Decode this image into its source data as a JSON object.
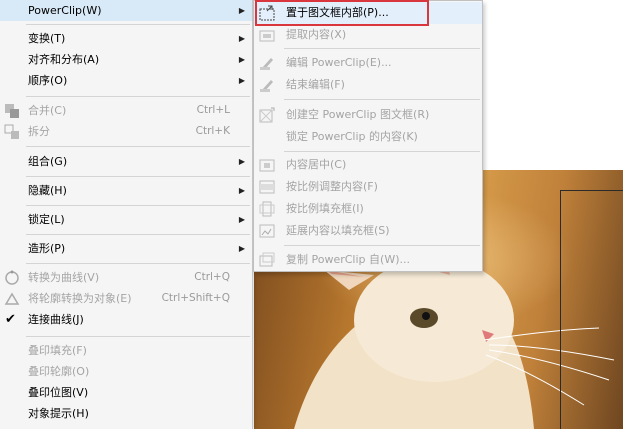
{
  "main_menu": {
    "items": [
      {
        "label": "PowerClip(W)",
        "shortcut": "",
        "submenu": true,
        "disabled": false
      },
      {
        "label": "变换(T)",
        "shortcut": "",
        "submenu": true,
        "disabled": false
      },
      {
        "label": "对齐和分布(A)",
        "shortcut": "",
        "submenu": true,
        "disabled": false
      },
      {
        "label": "顺序(O)",
        "shortcut": "",
        "submenu": true,
        "disabled": false
      },
      {
        "label": "合并(C)",
        "shortcut": "Ctrl+L",
        "submenu": false,
        "disabled": true
      },
      {
        "label": "拆分",
        "shortcut": "Ctrl+K",
        "submenu": false,
        "disabled": true
      },
      {
        "label": "组合(G)",
        "shortcut": "",
        "submenu": true,
        "disabled": false
      },
      {
        "label": "隐藏(H)",
        "shortcut": "",
        "submenu": true,
        "disabled": false
      },
      {
        "label": "锁定(L)",
        "shortcut": "",
        "submenu": true,
        "disabled": false
      },
      {
        "label": "造形(P)",
        "shortcut": "",
        "submenu": true,
        "disabled": false
      },
      {
        "label": "转换为曲线(V)",
        "shortcut": "Ctrl+Q",
        "submenu": false,
        "disabled": true
      },
      {
        "label": "将轮廓转换为对象(E)",
        "shortcut": "Ctrl+Shift+Q",
        "submenu": false,
        "disabled": true
      },
      {
        "label": "连接曲线(J)",
        "shortcut": "",
        "submenu": false,
        "disabled": false,
        "checked": true
      },
      {
        "label": "叠印填充(F)",
        "shortcut": "",
        "submenu": false,
        "disabled": true
      },
      {
        "label": "叠印轮廓(O)",
        "shortcut": "",
        "submenu": false,
        "disabled": true
      },
      {
        "label": "叠印位图(V)",
        "shortcut": "",
        "submenu": false,
        "disabled": false
      },
      {
        "label": "对象提示(H)",
        "shortcut": "",
        "submenu": false,
        "disabled": false
      }
    ]
  },
  "powerclip_submenu": {
    "items": [
      {
        "label": "置于图文框内部(P)...",
        "disabled": false,
        "icon": "place-inside-frame-icon"
      },
      {
        "label": "提取内容(X)",
        "disabled": true,
        "icon": "extract-contents-icon"
      },
      {
        "label": "编辑 PowerClip(E)...",
        "disabled": true,
        "icon": "edit-powerclip-icon"
      },
      {
        "label": "结束编辑(F)",
        "disabled": true,
        "icon": "finish-editing-icon"
      },
      {
        "label": "创建空 PowerClip 图文框(R)",
        "disabled": true,
        "icon": "create-empty-frame-icon"
      },
      {
        "label": "锁定 PowerClip 的内容(K)",
        "disabled": true,
        "icon": ""
      },
      {
        "label": "内容居中(C)",
        "disabled": true,
        "icon": "center-content-icon"
      },
      {
        "label": "按比例调整内容(F)",
        "disabled": true,
        "icon": "fit-content-proportionally-icon"
      },
      {
        "label": "按比例填充框(I)",
        "disabled": true,
        "icon": "fill-frame-proportionally-icon"
      },
      {
        "label": "延展内容以填充框(S)",
        "disabled": true,
        "icon": "stretch-content-icon"
      },
      {
        "label": "复制 PowerClip 自(W)...",
        "disabled": true,
        "icon": "copy-powerclip-from-icon"
      }
    ]
  },
  "colors": {
    "highlight": "#d8e9f7",
    "callout": "#d9363e",
    "disabled_text": "#a4a4a4"
  }
}
